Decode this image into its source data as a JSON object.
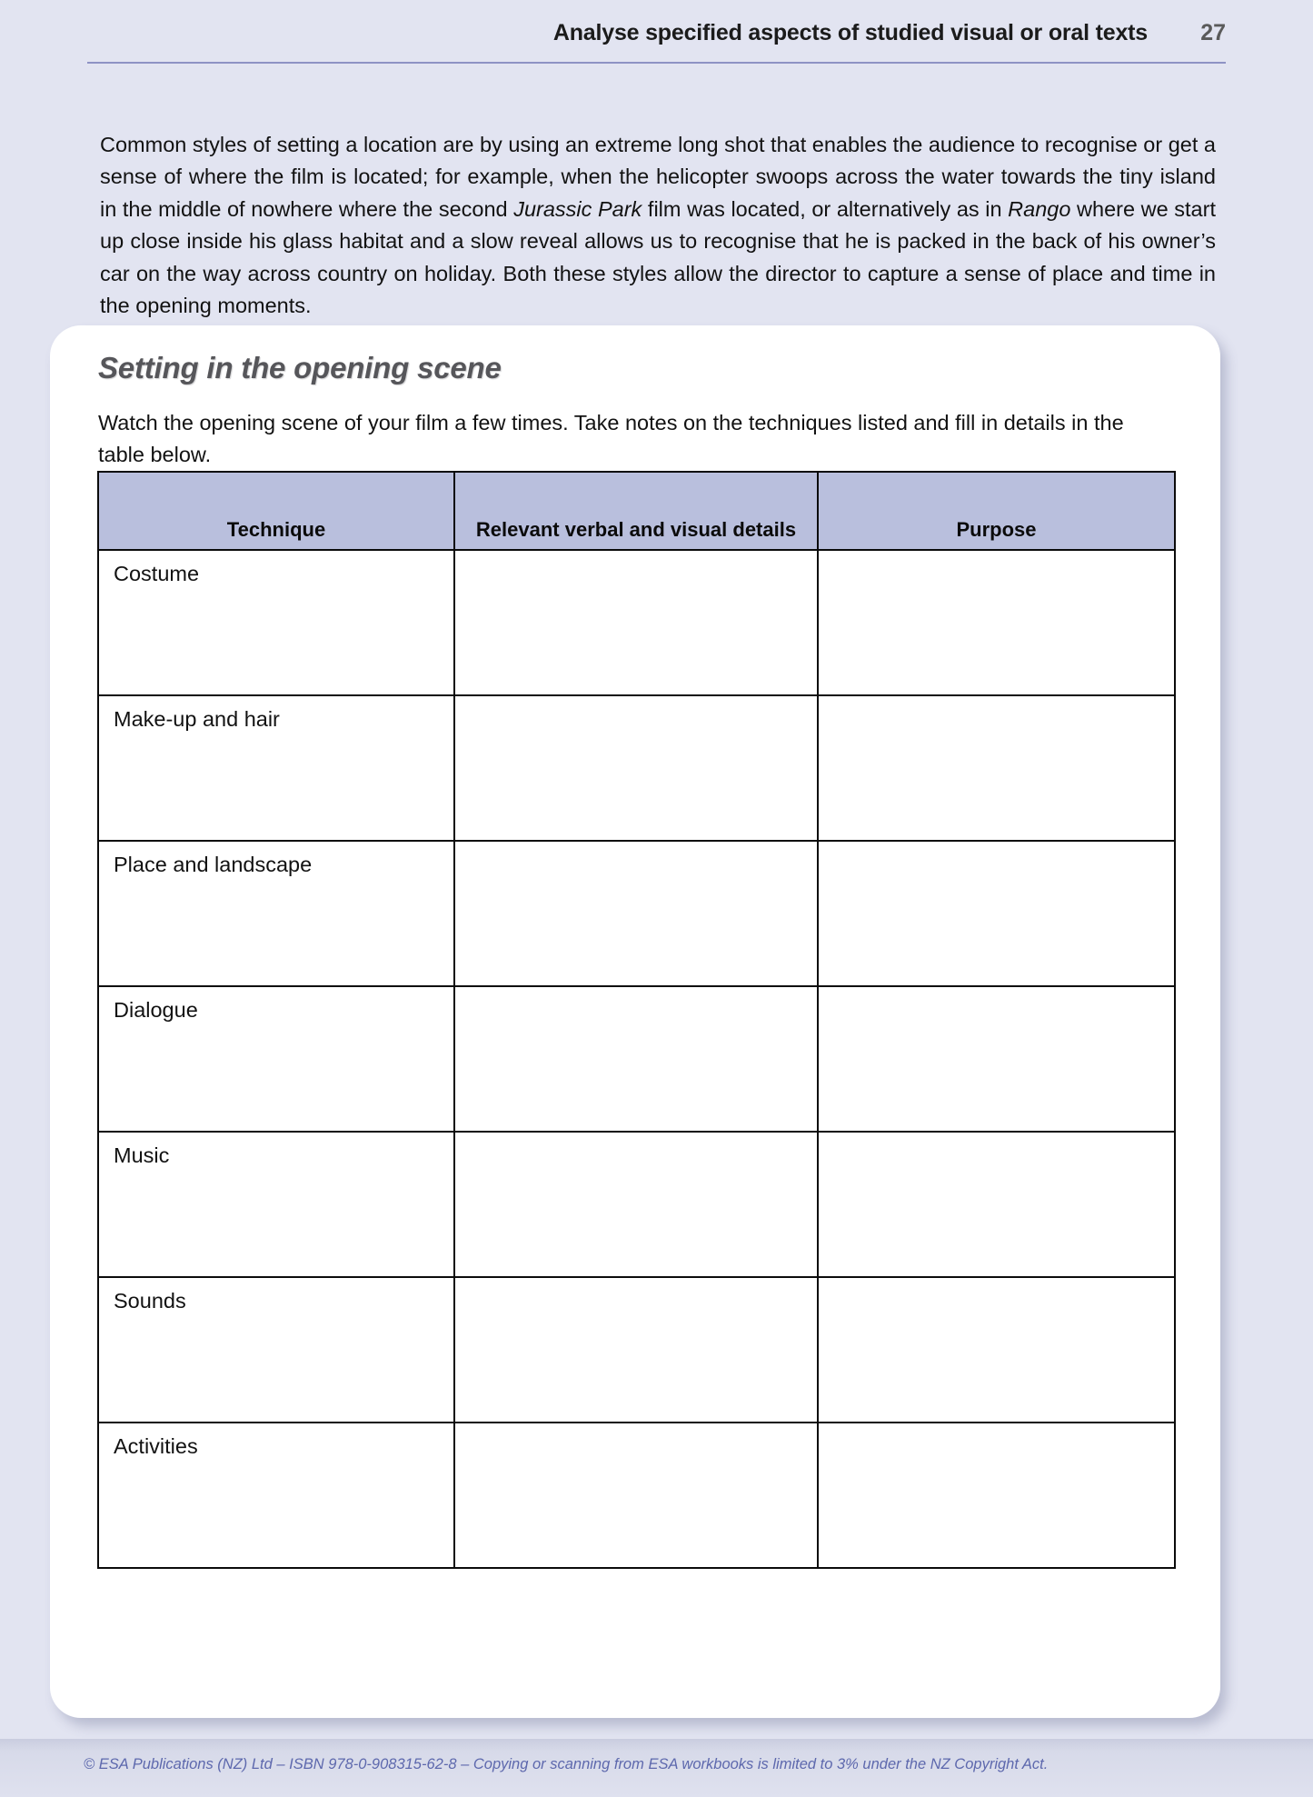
{
  "header": {
    "title": "Analyse specified aspects of studied visual or oral texts",
    "page_number": "27",
    "rule_color": "#8e93c4"
  },
  "intro": {
    "segment_1": "Common styles of setting a location are by using an extreme long shot that enables the audience to recognise or get a sense of where the film is located; for example, when the helicopter swoops across the water towards the tiny island in the middle of nowhere where the second ",
    "italic_1": "Jurassic Park",
    "segment_2": " film was located, or alternatively as in ",
    "italic_2": "Rango",
    "segment_3": " where we start up close inside his glass habitat and a slow reveal allows us to recognise that he is packed in the back of his owner’s car on the way across country on holiday. Both these styles allow the director to capture a sense of place and time in the opening moments."
  },
  "activity": {
    "heading": "Setting in the opening scene",
    "instruction": "Watch the opening scene of your film a few times. Take notes on the techniques listed and fill in details in the table below.",
    "table": {
      "header_fill": "#b9bfdd",
      "columns": [
        "Technique",
        "Relevant verbal and visual details",
        "Purpose"
      ],
      "rows": [
        {
          "technique": "Costume",
          "details": "",
          "purpose": ""
        },
        {
          "technique": "Make-up and hair",
          "details": "",
          "purpose": ""
        },
        {
          "technique": "Place and landscape",
          "details": "",
          "purpose": ""
        },
        {
          "technique": "Dialogue",
          "details": "",
          "purpose": ""
        },
        {
          "technique": "Music",
          "details": "",
          "purpose": ""
        },
        {
          "technique": "Sounds",
          "details": "",
          "purpose": ""
        },
        {
          "technique": "Activities",
          "details": "",
          "purpose": ""
        }
      ]
    }
  },
  "footer": {
    "text": "© ESA Publications (NZ) Ltd  –  ISBN 978-0-908315-62-8  –  Copying or scanning from ESA workbooks is limited to 3% under the NZ Copyright Act.",
    "color": "#5d68ad"
  }
}
